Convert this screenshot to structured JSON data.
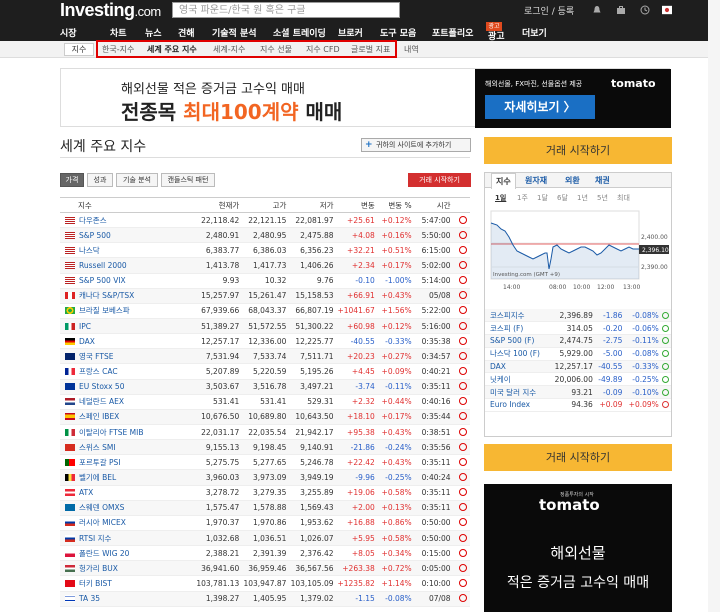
{
  "header": {
    "logo_main": "Investing",
    "logo_suffix": ".com",
    "search_placeholder": "영국 파운드/한국 원 혹은 구글",
    "login": "로그인 / 등록"
  },
  "nav": [
    "시장",
    "차트",
    "뉴스",
    "견해",
    "기술적 분석",
    "소셜 트레이딩",
    "브로커",
    "도구 모음",
    "포트폴리오",
    "광고",
    "더보기"
  ],
  "ad_badge": "광고",
  "subnav": {
    "selected": "지수",
    "items": [
      "한국-지수",
      "세계 주요 지수",
      "세계-지수",
      "지수 선물",
      "지수 CFD",
      "글로벌 지표",
      "내역"
    ]
  },
  "banner": {
    "line1": "해외선물 적은 증거금 고수익 매매",
    "line2_a": "전종목 ",
    "line2_b": "최대100계약",
    "line2_c": " 매매",
    "dark_text": "해외선물, FX마진, 선물옵션 제공",
    "dark_button": "자세히보기 〉",
    "dark_logo": "tomato"
  },
  "page_title": "세계 주요 지수",
  "add_button": "귀하의 사이트에 추가하기",
  "tabs": [
    "가격",
    "성과",
    "기술 분석",
    "캔들스틱 패턴"
  ],
  "alert_button": "거래 시작하기",
  "table": {
    "headers": [
      "지수",
      "현재가",
      "고가",
      "저가",
      "변동",
      "변동 %",
      "시간"
    ],
    "rows": [
      {
        "flag": "us",
        "name": "다우존스",
        "last": "22,118.42",
        "high": "22,121.15",
        "low": "22,081.97",
        "chg": "+25.61",
        "pct": "+0.12%",
        "time": "5:47:00",
        "dir": "pos"
      },
      {
        "flag": "us",
        "name": "S&P 500",
        "last": "2,480.91",
        "high": "2,480.95",
        "low": "2,475.88",
        "chg": "+4.08",
        "pct": "+0.16%",
        "time": "5:50:00",
        "dir": "pos"
      },
      {
        "flag": "us",
        "name": "나스닥",
        "last": "6,383.77",
        "high": "6,386.03",
        "low": "6,356.23",
        "chg": "+32.21",
        "pct": "+0.51%",
        "time": "6:15:00",
        "dir": "pos"
      },
      {
        "flag": "us",
        "name": "Russell 2000",
        "last": "1,413.78",
        "high": "1,417.73",
        "low": "1,406.26",
        "chg": "+2.34",
        "pct": "+0.17%",
        "time": "5:02:00",
        "dir": "pos"
      },
      {
        "flag": "us",
        "name": "S&P 500 VIX",
        "last": "9.93",
        "high": "10.32",
        "low": "9.76",
        "chg": "-0.10",
        "pct": "-1.00%",
        "time": "5:14:00",
        "dir": "neg"
      },
      {
        "flag": "ca",
        "name": "캐나다 S&P/TSX",
        "last": "15,257.97",
        "high": "15,261.47",
        "low": "15,158.53",
        "chg": "+66.91",
        "pct": "+0.43%",
        "time": "05/08",
        "dir": "pos"
      },
      {
        "flag": "br",
        "name": "브라질 보베스파",
        "last": "67,939.66",
        "high": "68,043.37",
        "low": "66,807.19",
        "chg": "+1041.67",
        "pct": "+1.56%",
        "time": "5:22:00",
        "dir": "pos"
      },
      {
        "flag": "mx",
        "name": "IPC",
        "last": "51,389.27",
        "high": "51,572.55",
        "low": "51,300.22",
        "chg": "+60.98",
        "pct": "+0.12%",
        "time": "5:16:00",
        "dir": "pos"
      },
      {
        "flag": "de",
        "name": "DAX",
        "last": "12,257.17",
        "high": "12,336.00",
        "low": "12,225.77",
        "chg": "-40.55",
        "pct": "-0.33%",
        "time": "0:35:38",
        "dir": "neg"
      },
      {
        "flag": "gb",
        "name": "영국 FTSE",
        "last": "7,531.94",
        "high": "7,533.74",
        "low": "7,511.71",
        "chg": "+20.23",
        "pct": "+0.27%",
        "time": "0:34:57",
        "dir": "pos"
      },
      {
        "flag": "fr",
        "name": "프랑스 CAC",
        "last": "5,207.89",
        "high": "5,220.59",
        "low": "5,195.26",
        "chg": "+4.45",
        "pct": "+0.09%",
        "time": "0:40:21",
        "dir": "pos"
      },
      {
        "flag": "eu",
        "name": "EU Stoxx 50",
        "last": "3,503.67",
        "high": "3,516.78",
        "low": "3,497.21",
        "chg": "-3.74",
        "pct": "-0.11%",
        "time": "0:35:11",
        "dir": "neg"
      },
      {
        "flag": "nl",
        "name": "네덜란드 AEX",
        "last": "531.41",
        "high": "531.41",
        "low": "529.31",
        "chg": "+2.32",
        "pct": "+0.44%",
        "time": "0:40:16",
        "dir": "pos"
      },
      {
        "flag": "es",
        "name": "스페인 IBEX",
        "last": "10,676.50",
        "high": "10,689.80",
        "low": "10,643.50",
        "chg": "+18.10",
        "pct": "+0.17%",
        "time": "0:35:44",
        "dir": "pos"
      },
      {
        "flag": "it",
        "name": "이탈리아 FTSE MIB",
        "last": "22,031.17",
        "high": "22,035.54",
        "low": "21,942.17",
        "chg": "+95.38",
        "pct": "+0.43%",
        "time": "0:38:51",
        "dir": "pos"
      },
      {
        "flag": "ch",
        "name": "스위스 SMI",
        "last": "9,155.13",
        "high": "9,198.45",
        "low": "9,140.91",
        "chg": "-21.86",
        "pct": "-0.24%",
        "time": "0:35:56",
        "dir": "neg"
      },
      {
        "flag": "pt",
        "name": "포르투갈 PSI",
        "last": "5,275.75",
        "high": "5,277.65",
        "low": "5,246.78",
        "chg": "+22.42",
        "pct": "+0.43%",
        "time": "0:35:11",
        "dir": "pos"
      },
      {
        "flag": "be",
        "name": "벨기에 BEL",
        "last": "3,960.03",
        "high": "3,973.09",
        "low": "3,949.19",
        "chg": "-9.96",
        "pct": "-0.25%",
        "time": "0:40:24",
        "dir": "neg"
      },
      {
        "flag": "at",
        "name": "ATX",
        "last": "3,278.72",
        "high": "3,279.35",
        "low": "3,255.89",
        "chg": "+19.06",
        "pct": "+0.58%",
        "time": "0:35:11",
        "dir": "pos"
      },
      {
        "flag": "se",
        "name": "스웨덴 OMXS",
        "last": "1,575.47",
        "high": "1,578.88",
        "low": "1,569.43",
        "chg": "+2.00",
        "pct": "+0.13%",
        "time": "0:35:11",
        "dir": "pos"
      },
      {
        "flag": "ru",
        "name": "러시아 MICEX",
        "last": "1,970.37",
        "high": "1,970.86",
        "low": "1,953.62",
        "chg": "+16.88",
        "pct": "+0.86%",
        "time": "0:50:00",
        "dir": "pos"
      },
      {
        "flag": "ru",
        "name": "RTSI 지수",
        "last": "1,032.68",
        "high": "1,036.51",
        "low": "1,026.07",
        "chg": "+5.95",
        "pct": "+0.58%",
        "time": "0:50:00",
        "dir": "pos"
      },
      {
        "flag": "pl",
        "name": "폴란드 WIG 20",
        "last": "2,388.21",
        "high": "2,391.39",
        "low": "2,376.42",
        "chg": "+8.05",
        "pct": "+0.34%",
        "time": "0:15:00",
        "dir": "pos"
      },
      {
        "flag": "hu",
        "name": "헝가리 BUX",
        "last": "36,941.60",
        "high": "36,959.46",
        "low": "36,567.56",
        "chg": "+263.38",
        "pct": "+0.72%",
        "time": "0:05:00",
        "dir": "pos"
      },
      {
        "flag": "tr",
        "name": "터키 BIST",
        "last": "103,781.13",
        "high": "103,947.87",
        "low": "103,105.09",
        "chg": "+1235.82",
        "pct": "+1.14%",
        "time": "0:10:00",
        "dir": "pos"
      },
      {
        "flag": "il",
        "name": "TA 35",
        "last": "1,398.27",
        "high": "1,405.95",
        "low": "1,379.02",
        "chg": "-1.15",
        "pct": "-0.08%",
        "time": "07/08",
        "dir": "neg"
      }
    ]
  },
  "side": {
    "start_button": "거래 시작하기",
    "tabs": [
      "지수",
      "원자재",
      "외환",
      "채권"
    ],
    "periods": [
      "1일",
      "1주",
      "1달",
      "6달",
      "1년",
      "5년",
      "최대"
    ],
    "chart_source": "Investing.com (GMT +9)",
    "chart_price_tag": "2,396.10",
    "y_ticks": [
      "2,400.00",
      "2,390.00"
    ],
    "x_ticks": [
      "14:00",
      "08:00",
      "10:00",
      "12:00",
      "13:00"
    ],
    "rows": [
      {
        "name": "코스피지수",
        "last": "2,396.89",
        "chg": "-1.86",
        "pct": "-0.08%",
        "dir": "neg",
        "dot": "g"
      },
      {
        "name": "코스피 (F)",
        "last": "314.05",
        "chg": "-0.20",
        "pct": "-0.06%",
        "dir": "neg",
        "dot": "g"
      },
      {
        "name": "S&P 500 (F)",
        "last": "2,474.75",
        "chg": "-2.75",
        "pct": "-0.11%",
        "dir": "neg",
        "dot": "g"
      },
      {
        "name": "나스닥 100 (F)",
        "last": "5,929.00",
        "chg": "-5.00",
        "pct": "-0.08%",
        "dir": "neg",
        "dot": "g"
      },
      {
        "name": "DAX",
        "last": "12,257.17",
        "chg": "-40.55",
        "pct": "-0.33%",
        "dir": "neg",
        "dot": "g"
      },
      {
        "name": "닛케이",
        "last": "20,006.00",
        "chg": "-49.89",
        "pct": "-0.25%",
        "dir": "neg",
        "dot": "g"
      },
      {
        "name": "미국 달러 지수",
        "last": "93.21",
        "chg": "-0.09",
        "pct": "-0.10%",
        "dir": "neg",
        "dot": "g"
      },
      {
        "name": "Euro Index",
        "last": "94.36",
        "chg": "+0.09",
        "pct": "+0.09%",
        "dir": "pos",
        "dot": "r"
      }
    ],
    "start_button2": "거래 시작하기",
    "ad_logo": "tomato",
    "ad_logo_small": "정품투자의 시작",
    "ad_line1": "해외선물",
    "ad_line2": "적은 증거금 고수익 매매"
  }
}
